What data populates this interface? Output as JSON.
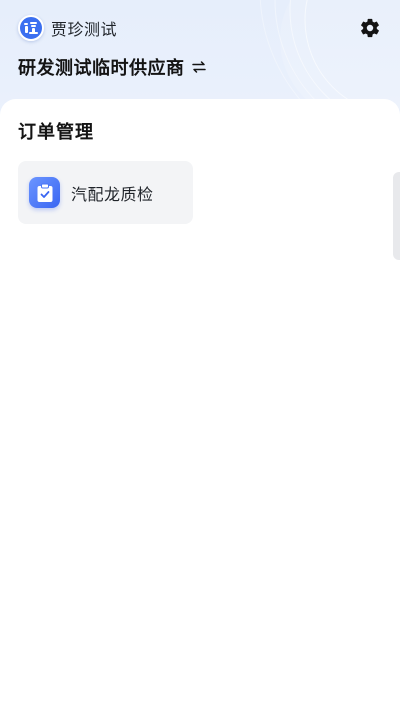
{
  "header": {
    "username": "贾珍测试",
    "organization": "研发测试临时供应商",
    "avatar_icon": "user-logo-icon",
    "switch_icon": "switch-arrows-icon",
    "settings_icon": "gear-icon"
  },
  "orders": {
    "section_title": "订单管理",
    "apps": [
      {
        "label": "汽配龙质检",
        "icon": "clipboard-check-icon"
      }
    ]
  },
  "colors": {
    "accent": "#3a66f2",
    "header_bg": "#e6eefb",
    "tile_bg": "#f3f4f6",
    "text_primary": "#141414"
  }
}
